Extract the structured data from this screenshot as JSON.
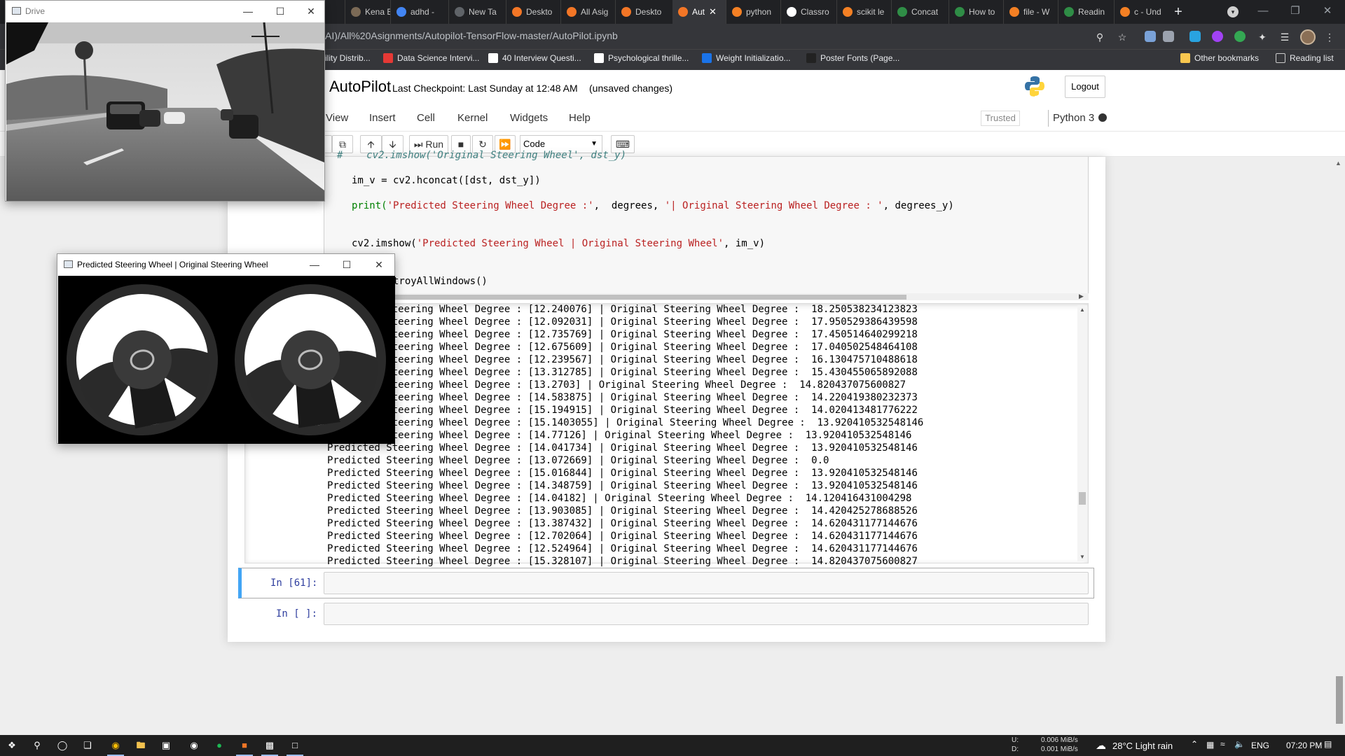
{
  "browser": {
    "tabs": [
      {
        "label": "Kena B",
        "icon": "avatar-icon",
        "color": "#7b6a56"
      },
      {
        "label": "adhd -",
        "icon": "google-icon",
        "color": "#4285f4"
      },
      {
        "label": "New Ta",
        "icon": "chrome-icon",
        "color": "#5f6368"
      },
      {
        "label": "Deskto",
        "icon": "jupyter-icon",
        "color": "#f37626"
      },
      {
        "label": "All Asig",
        "icon": "jupyter-icon",
        "color": "#f37626"
      },
      {
        "label": "Deskto",
        "icon": "jupyter-icon",
        "color": "#f37626"
      },
      {
        "label": "Aut",
        "icon": "hourglass-icon",
        "color": "#f37626"
      },
      {
        "label": "python",
        "icon": "stackoverflow-icon",
        "color": "#f48024"
      },
      {
        "label": "Classro",
        "icon": "classroom-icon",
        "color": "#ffffff"
      },
      {
        "label": "scikit le",
        "icon": "stackoverflow-icon",
        "color": "#f48024"
      },
      {
        "label": "Concat",
        "icon": "geeks-icon",
        "color": "#2f8d46"
      },
      {
        "label": "How to",
        "icon": "geeks-icon",
        "color": "#2f8d46"
      },
      {
        "label": "file - W",
        "icon": "stackoverflow-icon",
        "color": "#f48024"
      },
      {
        "label": "Readin",
        "icon": "geeks-icon",
        "color": "#2f8d46"
      },
      {
        "label": "c - Und",
        "icon": "stackoverflow-icon",
        "color": "#f48024"
      }
    ],
    "active_tab_index": 6,
    "url": "AI)/All%20Asignments/Autopilot-TensorFlow-master/AutoPilot.ipynb",
    "bookmarks": [
      {
        "label": "ility Distrib...",
        "icon": "",
        "color": "#35363a"
      },
      {
        "label": "Data Science Intervi...",
        "icon": "pin-icon",
        "color": "#e53935"
      },
      {
        "label": "40 Interview Questi...",
        "icon": "edit-icon",
        "color": "#ffffff"
      },
      {
        "label": "Psychological thrille...",
        "icon": "wikipedia-icon",
        "color": "#ffffff"
      },
      {
        "label": "Weight Initializatio...",
        "icon": "tds-icon",
        "color": "#1a73e8"
      },
      {
        "label": "Poster Fonts (Page...",
        "icon": "circle-icon",
        "color": "#222222"
      }
    ],
    "other_bookmarks": "Other bookmarks",
    "reading_list": "Reading list"
  },
  "jupyter": {
    "title": "AutoPilot",
    "checkpoint": "Last Checkpoint: Last Sunday at 12:48 AM",
    "unsaved": "(unsaved changes)",
    "logout": "Logout",
    "menus": [
      "View",
      "Insert",
      "Cell",
      "Kernel",
      "Widgets",
      "Help"
    ],
    "trusted": "Trusted",
    "kernel": "Python 3",
    "run_label": "Run",
    "cell_type": "Code"
  },
  "code": {
    "line1_comment": "#    cv2.imshow('Original Steering Wheel', dst_y)",
    "line2": "im_v = cv2.hconcat([dst, dst_y])",
    "line3_a": "print(",
    "line3_s1": "'Predicted Steering Wheel Degree :'",
    "line3_b": ",  degrees, ",
    "line3_s2": "'| Original Steering Wheel Degree : '",
    "line3_c": ", degrees_y)",
    "line4_a": "cv2.imshow(",
    "line4_s": "'Predicted Steering Wheel | Original Steering Wheel'",
    "line4_b": ", im_v)",
    "line5": "cv2.destroyAllWindows()"
  },
  "output_lines": [
    "Predicted Steering Wheel Degree : [12.240076] | Original Steering Wheel Degree :  18.250538234123823",
    "Predicted Steering Wheel Degree : [12.092031] | Original Steering Wheel Degree :  17.950529386439598",
    "Predicted Steering Wheel Degree : [12.735769] | Original Steering Wheel Degree :  17.450514640299218",
    "Predicted Steering Wheel Degree : [12.675609] | Original Steering Wheel Degree :  17.040502548464108",
    "Predicted Steering Wheel Degree : [12.239567] | Original Steering Wheel Degree :  16.130475710488618",
    "Predicted Steering Wheel Degree : [13.312785] | Original Steering Wheel Degree :  15.430455065892088",
    "Predicted Steering Wheel Degree : [13.2703] | Original Steering Wheel Degree :  14.820437075600827",
    "Predicted Steering Wheel Degree : [14.583875] | Original Steering Wheel Degree :  14.220419380232373",
    "Predicted Steering Wheel Degree : [15.194915] | Original Steering Wheel Degree :  14.020413481776222",
    "Predicted Steering Wheel Degree : [15.1403055] | Original Steering Wheel Degree :  13.920410532548146",
    "Predicted Steering Wheel Degree : [14.77126] | Original Steering Wheel Degree :  13.920410532548146",
    "Predicted Steering Wheel Degree : [14.041734] | Original Steering Wheel Degree :  13.920410532548146",
    "Predicted Steering Wheel Degree : [13.072669] | Original Steering Wheel Degree :  0.0",
    "Predicted Steering Wheel Degree : [15.016844] | Original Steering Wheel Degree :  13.920410532548146",
    "Predicted Steering Wheel Degree : [14.348759] | Original Steering Wheel Degree :  13.920410532548146",
    "Predicted Steering Wheel Degree : [14.04182] | Original Steering Wheel Degree :  14.120416431004298",
    "Predicted Steering Wheel Degree : [13.903085] | Original Steering Wheel Degree :  14.420425278688526",
    "Predicted Steering Wheel Degree : [13.387432] | Original Steering Wheel Degree :  14.620431177144676",
    "Predicted Steering Wheel Degree : [12.702064] | Original Steering Wheel Degree :  14.620431177144676",
    "Predicted Steering Wheel Degree : [12.524964] | Original Steering Wheel Degree :  14.620431177144676",
    "Predicted Steering Wheel Degree : [15.328107] | Original Steering Wheel Degree :  14.820437075600827"
  ],
  "cells": {
    "prompt_61": "In [61]:",
    "prompt_empty": "In [ ]:"
  },
  "windows": {
    "drive_title": "Drive",
    "steer_title": "Predicted Steering Wheel | Original Steering Wheel"
  },
  "taskbar": {
    "net_up_label": "U:",
    "net_down_label": "D:",
    "net_up": "0.006 MiB/s",
    "net_down": "0.001 MiB/s",
    "weather": "28°C  Light rain",
    "lang": "ENG",
    "time": "07:20 PM"
  }
}
